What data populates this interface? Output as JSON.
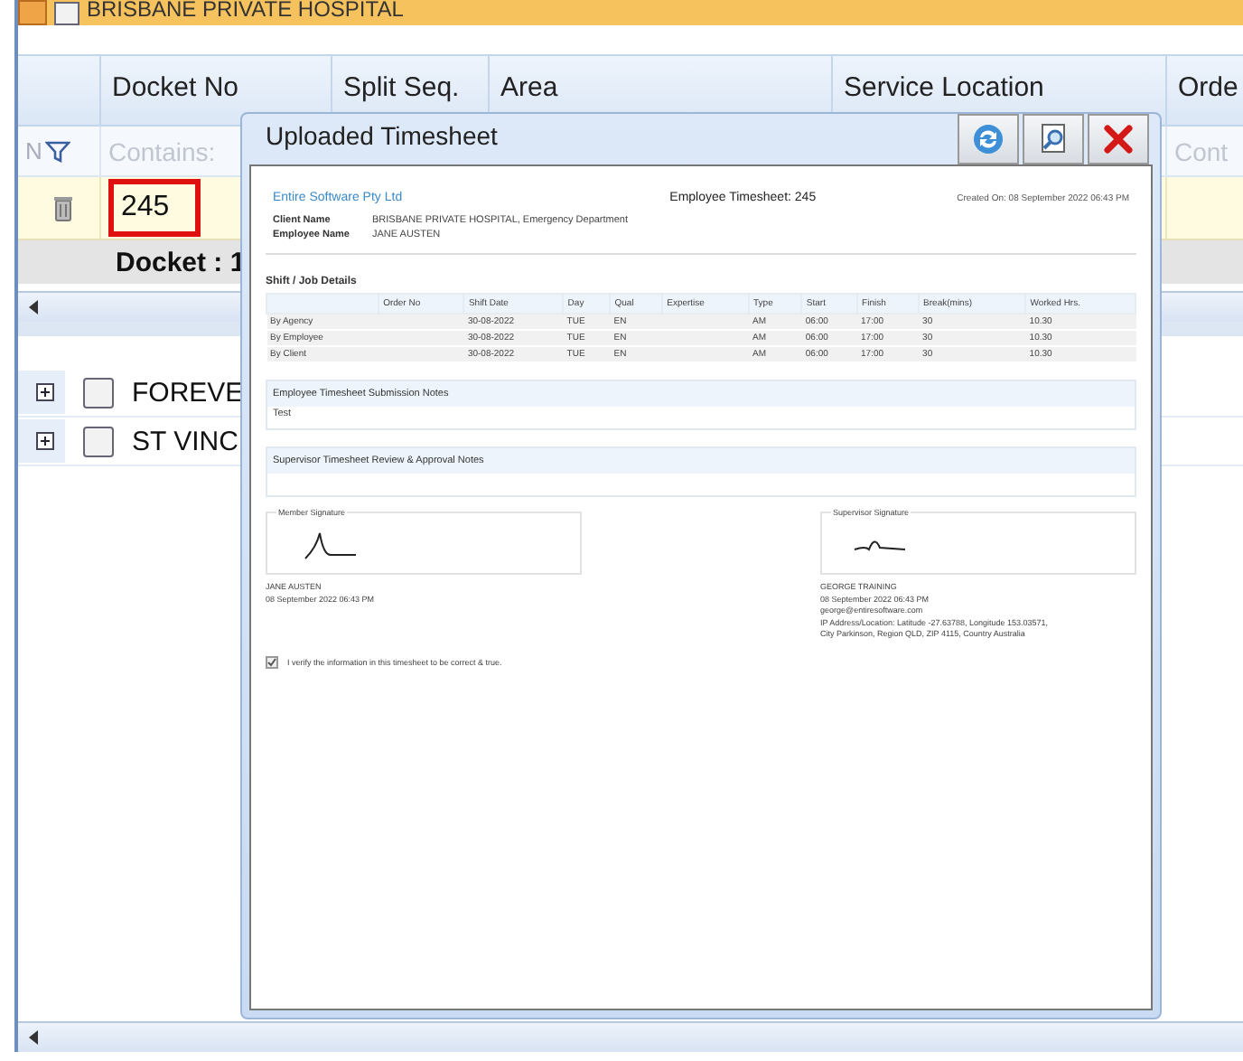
{
  "group_row": {
    "label": "BRISBANE PRIVATE HOSPITAL",
    "expanded": true,
    "checked": false
  },
  "grid": {
    "columns": [
      "Docket No",
      "Split Seq.",
      "Area",
      "Service Location",
      "Orde"
    ],
    "filter_row": {
      "first": "N",
      "cells": [
        {
          "placeholder": "Contains:"
        },
        {},
        {},
        {},
        {
          "placeholder": "Cont"
        }
      ]
    },
    "rows": [
      {
        "docket_no": "245",
        "highlighted": true
      }
    ],
    "group_footer": "Docket : 1"
  },
  "other_groups": [
    {
      "label": "FOREVE",
      "expanded": false,
      "checked": false
    },
    {
      "label": "ST VINC",
      "expanded": false,
      "checked": false
    }
  ],
  "dialog": {
    "title": "Uploaded Timesheet",
    "document": {
      "company": "Entire Software Pty Ltd",
      "title": "Employee Timesheet: 245",
      "created": "Created On: 08 September 2022 06:43 PM",
      "fields": [
        {
          "label": "Client Name",
          "value": "BRISBANE PRIVATE HOSPITAL, Emergency Department"
        },
        {
          "label": "Employee Name",
          "value": "JANE AUSTEN"
        }
      ],
      "shift_heading": "Shift / Job Details",
      "shift_columns": [
        "",
        "Order No",
        "Shift Date",
        "Day",
        "Qual",
        "Expertise",
        "Type",
        "Start",
        "Finish",
        "Break(mins)",
        "Worked Hrs."
      ],
      "shift_rows": [
        [
          "By Agency",
          "",
          "30-08-2022",
          "TUE",
          "EN",
          "",
          "AM",
          "06:00",
          "17:00",
          "30",
          "10.30"
        ],
        [
          "By Employee",
          "",
          "30-08-2022",
          "TUE",
          "EN",
          "",
          "AM",
          "06:00",
          "17:00",
          "30",
          "10.30"
        ],
        [
          "By Client",
          "",
          "30-08-2022",
          "TUE",
          "EN",
          "",
          "AM",
          "06:00",
          "17:00",
          "30",
          "10.30"
        ]
      ],
      "notes": [
        {
          "heading": "Employee Timesheet Submission Notes",
          "text": "Test"
        },
        {
          "heading": "Supervisor Timesheet Review & Approval Notes"
        }
      ],
      "signatures": [
        {
          "label": "Member Signature",
          "lines": [
            "JANE AUSTEN",
            "08 September 2022 06:43 PM"
          ]
        },
        {
          "label": "Supervisor Signature",
          "lines": [
            "GEORGE TRAINING",
            "08 September 2022 06:43 PM",
            "george@entiresoftware.com",
            "IP Address/Location: Latitude -27.63788, Longitude 153.03571,",
            "City Parkinson, Region QLD, ZIP 4115, Country Australia"
          ]
        }
      ],
      "verify": {
        "label": "I verify the information in this timesheet to be correct & true.",
        "checked": true
      }
    }
  }
}
